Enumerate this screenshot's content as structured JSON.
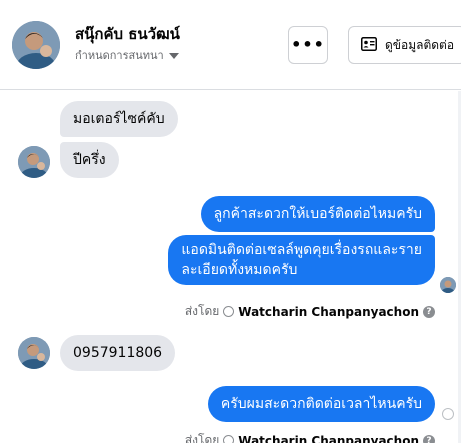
{
  "header": {
    "contact_name": "สนุ๊กคับ ธนวัฒน์",
    "subtitle": "กำหนดการสนทนา",
    "more_label": "•••",
    "info_label": "ดูข้อมูลติดต่อ",
    "caret_icon": "chevron-down-icon",
    "more_icon": "more-horizontal-icon",
    "info_icon": "contact-card-icon"
  },
  "messages": [
    {
      "direction": "in",
      "text": "มอเตอร์ไซค์คับ"
    },
    {
      "direction": "in",
      "text": "ปีครึ่ง"
    },
    {
      "direction": "out",
      "text": "ลูกค้าสะดวกให้เบอร์ติดต่อไหมครับ"
    },
    {
      "direction": "out",
      "lines": [
        "แอดมินติดต่อเซลล์พูดคุยเรื่องรถและราย",
        "ละเอียดทั้งหมดครับ"
      ]
    },
    {
      "direction": "in",
      "text": "0957911806"
    },
    {
      "direction": "out",
      "text": "ครับผมสะดวกติดต่อเวลาไหนครับ"
    }
  ],
  "sent_by_1": {
    "prefix": "ส่งโดย",
    "sender": "Watcharin Chanpanyachon"
  },
  "sent_by_2": {
    "prefix": "ส่งโดย",
    "sender": "Watcharin Chanpanyachon"
  },
  "colors": {
    "outgoing_bubble": "#1877f2",
    "incoming_bubble": "#e4e6eb",
    "secondary_text": "#65676b"
  }
}
